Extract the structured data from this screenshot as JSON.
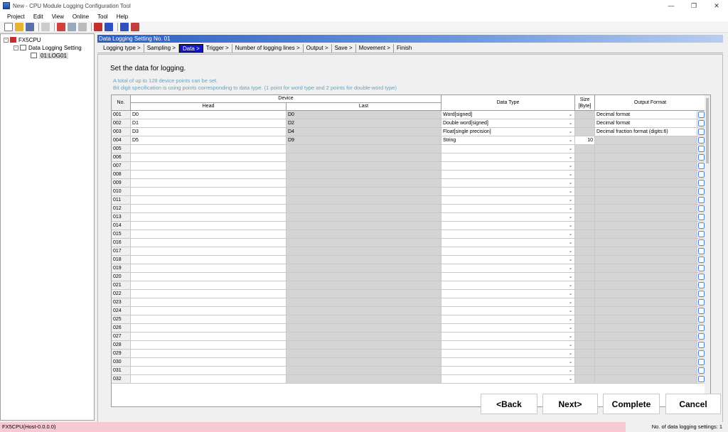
{
  "window": {
    "title": "New - CPU Module Logging Configuration Tool"
  },
  "menu": [
    "Project",
    "Edit",
    "View",
    "Online",
    "Tool",
    "Help"
  ],
  "tree": {
    "root": "FX5CPU",
    "node": "Data Logging Setting",
    "leaf": "01:LOG01"
  },
  "header": {
    "title": "Data Logging Setting No. 01"
  },
  "steps": [
    "Logging type >",
    "Sampling >",
    "Data >",
    "Trigger >",
    "Number of logging lines >",
    "Output >",
    "Save >",
    "Movement >",
    "Finish"
  ],
  "active_step": 2,
  "panel": {
    "heading": "Set the data for logging.",
    "note1": "A total of up to 128 device points can be set.",
    "note2": "Bit digit specification is using points corresponding to data type. (1 point for word type and 2 points for double-word type)"
  },
  "table": {
    "headers": {
      "no": "No.",
      "device": "Device",
      "head": "Head",
      "last": "Last",
      "data_type": "Data Type",
      "size": "Size [Byte]",
      "size_line1": "Size",
      "size_line2": "[Byte]",
      "output_format": "Output Format"
    },
    "rows": [
      {
        "no": "001",
        "head": "D0",
        "last": "D0",
        "type": "Word[signed]",
        "size": "",
        "format": "Decimal format"
      },
      {
        "no": "002",
        "head": "D1",
        "last": "D2",
        "type": "Double word[signed]",
        "size": "",
        "format": "Decimal format"
      },
      {
        "no": "003",
        "head": "D3",
        "last": "D4",
        "type": "Float[single precision]",
        "size": "",
        "format": "Decimal fraction format (digits:6)"
      },
      {
        "no": "004",
        "head": "D5",
        "last": "D9",
        "type": "String",
        "size": "10",
        "format": ""
      },
      {
        "no": "005"
      },
      {
        "no": "006"
      },
      {
        "no": "007"
      },
      {
        "no": "008"
      },
      {
        "no": "009"
      },
      {
        "no": "010"
      },
      {
        "no": "011"
      },
      {
        "no": "012"
      },
      {
        "no": "013"
      },
      {
        "no": "014"
      },
      {
        "no": "015"
      },
      {
        "no": "016"
      },
      {
        "no": "017"
      },
      {
        "no": "018"
      },
      {
        "no": "019"
      },
      {
        "no": "020"
      },
      {
        "no": "021"
      },
      {
        "no": "022"
      },
      {
        "no": "023"
      },
      {
        "no": "024"
      },
      {
        "no": "025"
      },
      {
        "no": "026"
      },
      {
        "no": "027"
      },
      {
        "no": "028"
      },
      {
        "no": "029"
      },
      {
        "no": "030"
      },
      {
        "no": "031"
      },
      {
        "no": "032"
      }
    ]
  },
  "buttons": {
    "back": "<Back",
    "next": "Next>",
    "complete": "Complete",
    "cancel": "Cancel"
  },
  "status": {
    "left": "FX5CPU(Host-0.0.0.0)",
    "right": "No. of data logging settings: 1"
  }
}
